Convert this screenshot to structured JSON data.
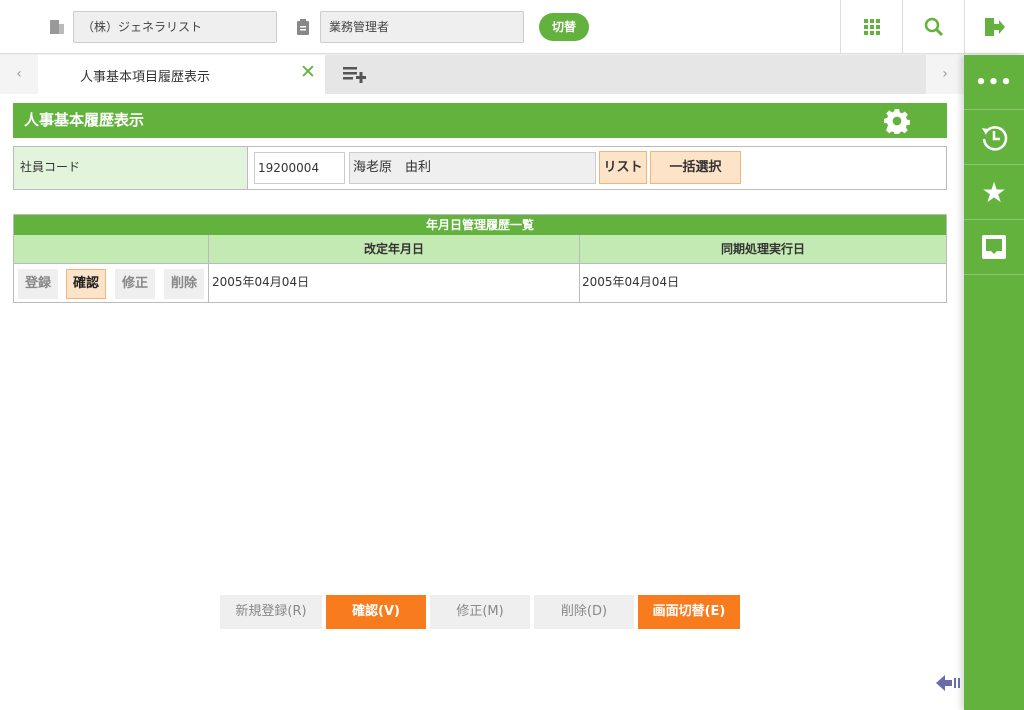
{
  "topbar": {
    "company": "（株）ジェネラリスト",
    "role": "業務管理者",
    "switch_label": "切替"
  },
  "tabs": {
    "active_label": "人事基本項目履歴表示"
  },
  "page": {
    "title": "人事基本履歴表示"
  },
  "employee": {
    "label": "社員コード",
    "code": "19200004",
    "name": "海老原　由利",
    "list_button": "リスト",
    "bulk_button": "一括選択"
  },
  "history": {
    "title": "年月日管理履歴一覧",
    "columns": [
      "改定年月日",
      "同期処理実行日"
    ],
    "rows": [
      {
        "actions": [
          "登録",
          "確認",
          "修正",
          "削除"
        ],
        "revision_date": "2005年04月04日",
        "sync_date": "2005年04月04日"
      }
    ]
  },
  "footer": {
    "buttons": [
      "新規登録(R)",
      "確認(V)",
      "修正(M)",
      "削除(D)",
      "画面切替(E)"
    ]
  }
}
